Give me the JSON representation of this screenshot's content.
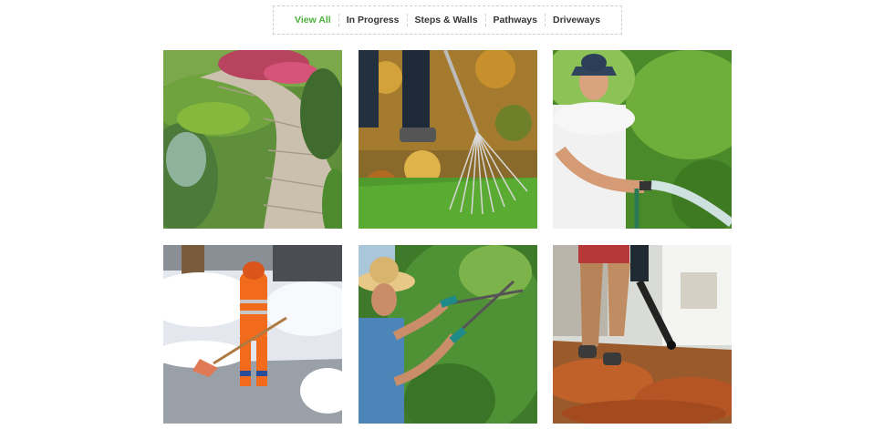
{
  "filters": [
    {
      "label": "View All",
      "active": true
    },
    {
      "label": "In Progress",
      "active": false
    },
    {
      "label": "Steps & Walls",
      "active": false
    },
    {
      "label": "Pathways",
      "active": false
    },
    {
      "label": "Driveways",
      "active": false
    }
  ],
  "accent_color": "#4caf3c",
  "gallery": [
    {
      "subject": "stone garden pathway with plants"
    },
    {
      "subject": "raking autumn leaves on grass"
    },
    {
      "subject": "man in hat watering garden with hose"
    },
    {
      "subject": "worker in orange shoveling snow"
    },
    {
      "subject": "gardener in straw hat trimming hedge"
    },
    {
      "subject": "person using leaf blower on autumn leaves"
    }
  ]
}
